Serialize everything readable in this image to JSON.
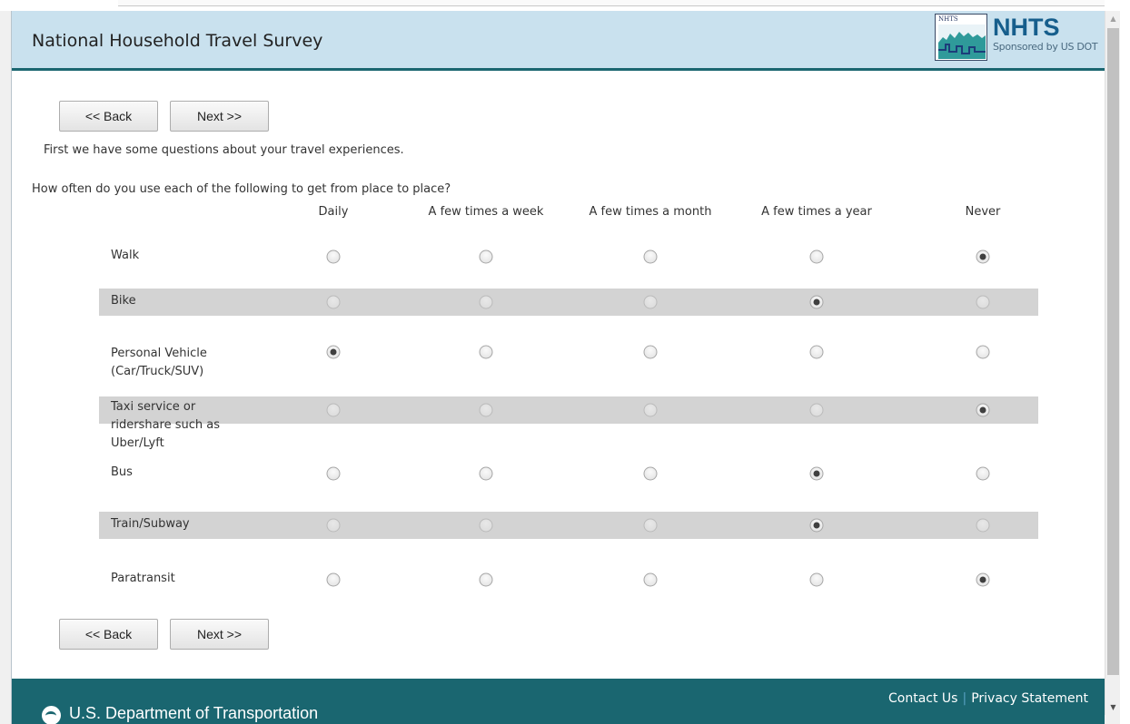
{
  "header": {
    "title": "National Household Travel Survey",
    "logo_small_text": "NHTS",
    "logo_name": "NHTS",
    "logo_sponsor": "Sponsored by US DOT"
  },
  "nav": {
    "back_label": "<< Back",
    "next_label": "Next >>"
  },
  "intro_text": "First we have some questions about your travel experiences.",
  "question_text": "How often do you use each of the following to get from place to place?",
  "columns": [
    "Daily",
    "A few times a week",
    "A few times a month",
    "A few times a year",
    "Never"
  ],
  "rows": [
    {
      "label": "Walk",
      "selected": 4
    },
    {
      "label": "Bike",
      "selected": 3
    },
    {
      "label": "Personal Vehicle (Car/Truck/SUV)",
      "selected": 0
    },
    {
      "label": "Taxi service or ridershare such as Uber/Lyft",
      "selected": 4
    },
    {
      "label": "Bus",
      "selected": 3
    },
    {
      "label": "Train/Subway",
      "selected": 3
    },
    {
      "label": "Paratransit",
      "selected": 4
    }
  ],
  "footer": {
    "department": "U.S. Department of Transportation",
    "contact_label": "Contact Us",
    "separator": "|",
    "privacy_label": "Privacy Statement"
  },
  "colors": {
    "header_bg": "#c9e1ee",
    "accent_teal": "#1a6670",
    "row_shade": "#d3d3d3",
    "logo_blue": "#165e8c"
  },
  "icons": [
    "nhts-skyline-logo",
    "dot-logo-icon",
    "scroll-up-icon",
    "scroll-down-icon"
  ]
}
